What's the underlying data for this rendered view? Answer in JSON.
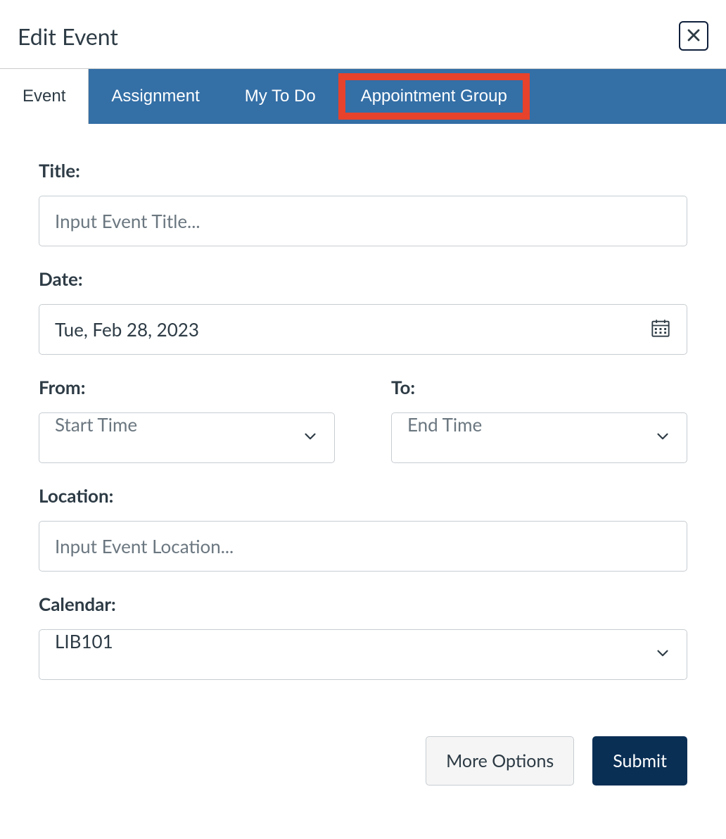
{
  "header": {
    "title": "Edit Event"
  },
  "tabs": {
    "event": "Event",
    "assignment": "Assignment",
    "my_todo": "My To Do",
    "appointment_group": "Appointment Group"
  },
  "form": {
    "title": {
      "label": "Title:",
      "placeholder": "Input Event Title..."
    },
    "date": {
      "label": "Date:",
      "value": "Tue, Feb 28, 2023"
    },
    "from": {
      "label": "From:",
      "placeholder": "Start Time"
    },
    "to": {
      "label": "To:",
      "placeholder": "End Time"
    },
    "location": {
      "label": "Location:",
      "placeholder": "Input Event Location..."
    },
    "calendar": {
      "label": "Calendar:",
      "value": "LIB101"
    }
  },
  "actions": {
    "more_options": "More Options",
    "submit": "Submit"
  }
}
